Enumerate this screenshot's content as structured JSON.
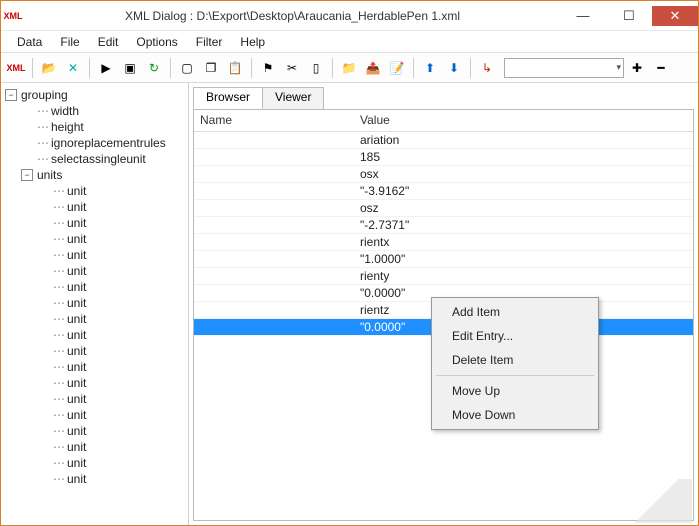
{
  "window": {
    "title": "XML Dialog : D:\\Export\\Desktop\\Araucania_HerdablePen 1.xml"
  },
  "menubar": [
    "Data",
    "File",
    "Edit",
    "Options",
    "Filter",
    "Help"
  ],
  "toolbar": {
    "xml_label": "XML"
  },
  "tree": {
    "root": "grouping",
    "children": [
      "width",
      "height",
      "ignoreplacementrules",
      "selectassingleunit"
    ],
    "units_label": "units",
    "unit_label": "unit",
    "unit_count": 19
  },
  "tabs": {
    "browser": "Browser",
    "viewer": "Viewer",
    "active": "browser"
  },
  "grid": {
    "columns": {
      "name": "Name",
      "value": "Value"
    },
    "rows": [
      {
        "name": "",
        "value": "ariation"
      },
      {
        "name": "",
        "value": "185"
      },
      {
        "name": "",
        "value": "osx"
      },
      {
        "name": "",
        "value": "\"-3.9162\""
      },
      {
        "name": "",
        "value": "osz"
      },
      {
        "name": "",
        "value": "\"-2.7371\""
      },
      {
        "name": "",
        "value": "rientx"
      },
      {
        "name": "",
        "value": "\"1.0000\""
      },
      {
        "name": "",
        "value": "rienty"
      },
      {
        "name": "",
        "value": "\"0.0000\""
      },
      {
        "name": "",
        "value": "rientz"
      },
      {
        "name": "",
        "value": "\"0.0000\"",
        "selected": true
      }
    ]
  },
  "context_menu": {
    "add": "Add Item",
    "edit": "Edit Entry...",
    "delete": "Delete Item",
    "moveup": "Move Up",
    "movedown": "Move Down"
  }
}
